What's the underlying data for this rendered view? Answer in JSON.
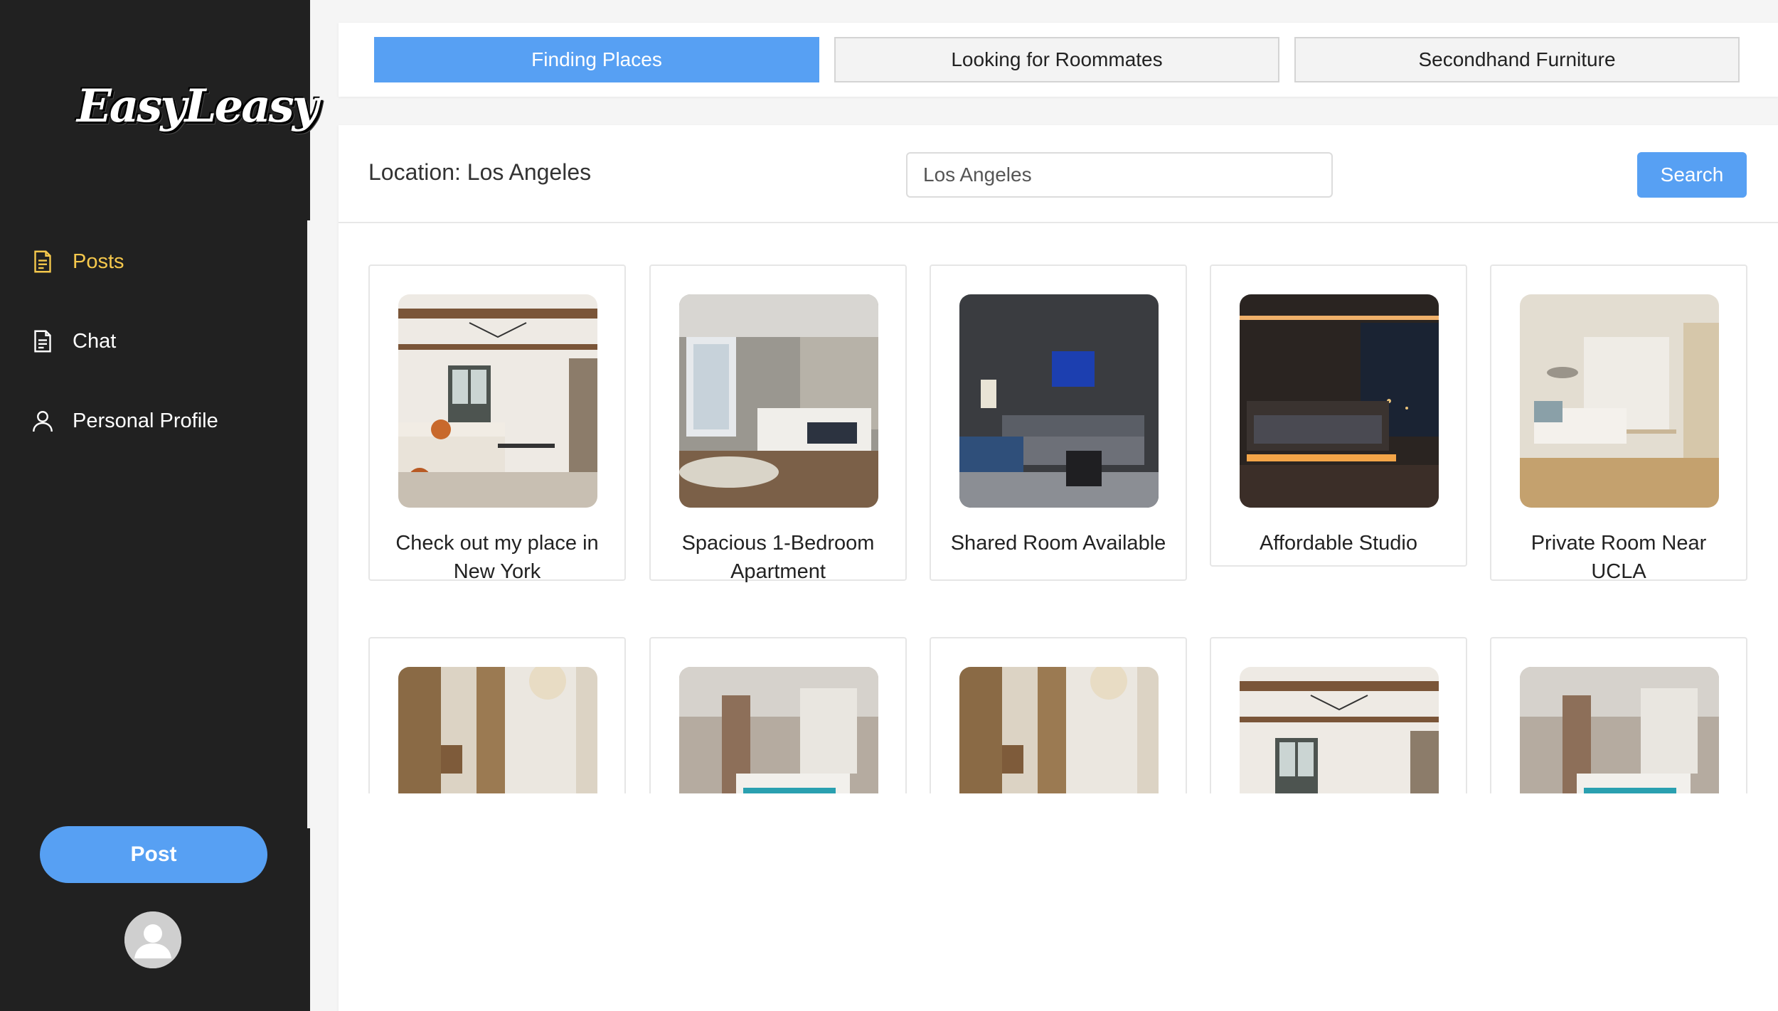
{
  "sidebar": {
    "logo_text": "EasyLeasy",
    "menu": [
      {
        "label": "Posts",
        "icon": "document-icon",
        "active": true
      },
      {
        "label": "Chat",
        "icon": "document-icon",
        "active": false
      },
      {
        "label": "Personal Profile",
        "icon": "user-icon",
        "active": false
      }
    ],
    "post_button_label": "Post",
    "avatar_icon": "user-avatar-icon"
  },
  "tabs": [
    {
      "label": "Finding Places",
      "active": true
    },
    {
      "label": "Looking for Roommates",
      "active": false
    },
    {
      "label": "Secondhand Furniture",
      "active": false
    }
  ],
  "search": {
    "location_label": "Location: Los Angeles",
    "input_value": "Los Angeles",
    "button_label": "Search"
  },
  "listings": [
    {
      "title": "Check out my place in New York",
      "image": "living-room-chandelier"
    },
    {
      "title": "Spacious 1-Bedroom Apartment",
      "image": "modern-bedroom-gray"
    },
    {
      "title": "Shared Room Available",
      "image": "dark-living-room-blue-art"
    },
    {
      "title": "Affordable Studio",
      "image": "dark-bedroom-night-view"
    },
    {
      "title": "Private Room Near UCLA",
      "image": "bright-hotel-room"
    },
    {
      "title": "",
      "image": "classic-sitting-room-curtains"
    },
    {
      "title": "",
      "image": "bedroom-teal-bedding"
    },
    {
      "title": "",
      "image": "classic-sitting-room-curtains"
    },
    {
      "title": "",
      "image": "living-room-chandelier"
    },
    {
      "title": "",
      "image": "bedroom-teal-bedding"
    }
  ],
  "colors": {
    "sidebar_bg": "#212121",
    "accent_blue": "#57a0f3",
    "active_menu": "#f5c84c",
    "page_bg": "#f5f5f5"
  }
}
